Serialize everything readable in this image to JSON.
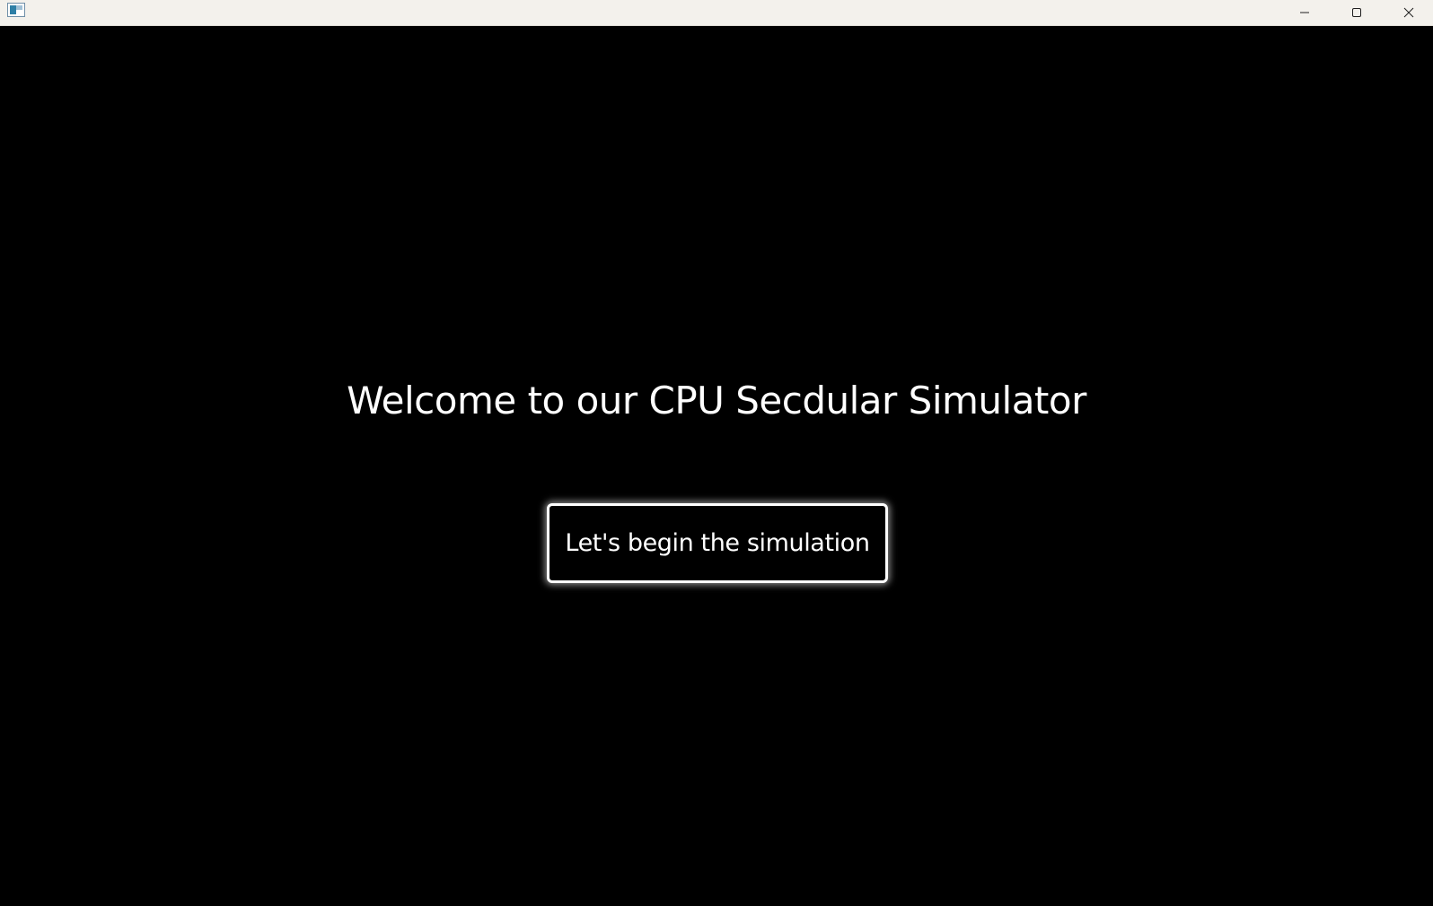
{
  "window": {
    "title": "",
    "icon": "app-window-icon",
    "controls": {
      "minimize_icon": "minimize-icon",
      "maximize_icon": "maximize-icon",
      "close_icon": "close-icon"
    }
  },
  "main": {
    "headline": "Welcome to our CPU Secdular Simulator",
    "start_button_label": "Let's begin the simulation"
  },
  "colors": {
    "background": "#000000",
    "text": "#ffffff",
    "titlebar": "#f3f1ec",
    "button_border": "#ffffff"
  }
}
